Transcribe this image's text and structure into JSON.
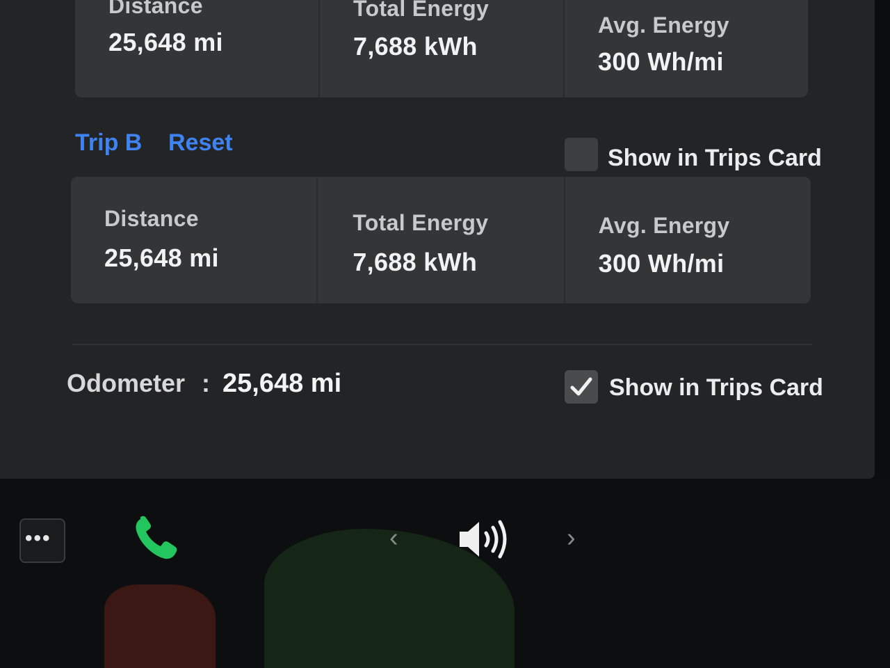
{
  "trip_a": {
    "distance_label": "Distance",
    "distance_value": "25,648 mi",
    "energy_label": "Total Energy",
    "energy_value": "7,688 kWh",
    "avg_label": "Avg. Energy",
    "avg_value": "300 Wh/mi"
  },
  "trip_b": {
    "title": "Trip B",
    "reset_label": "Reset",
    "show_in_trips_label": "Show in Trips Card",
    "show_in_trips_checked": false,
    "distance_label": "Distance",
    "distance_value": "25,648 mi",
    "energy_label": "Total Energy",
    "energy_value": "7,688 kWh",
    "avg_label": "Avg. Energy",
    "avg_value": "300 Wh/mi"
  },
  "odometer": {
    "label": "Odometer",
    "separator": ":",
    "value": "25,648 mi",
    "show_in_trips_label": "Show in Trips Card",
    "show_in_trips_checked": true
  },
  "dock": {
    "more_label": "•••",
    "prev_label": "‹",
    "next_label": "›",
    "icons": [
      "more-icon",
      "phone-icon",
      "volume-icon"
    ],
    "phone_color": "#22c55e"
  },
  "colors": {
    "accent": "#3e83f1",
    "panel": "#232426",
    "card": "#343537"
  }
}
